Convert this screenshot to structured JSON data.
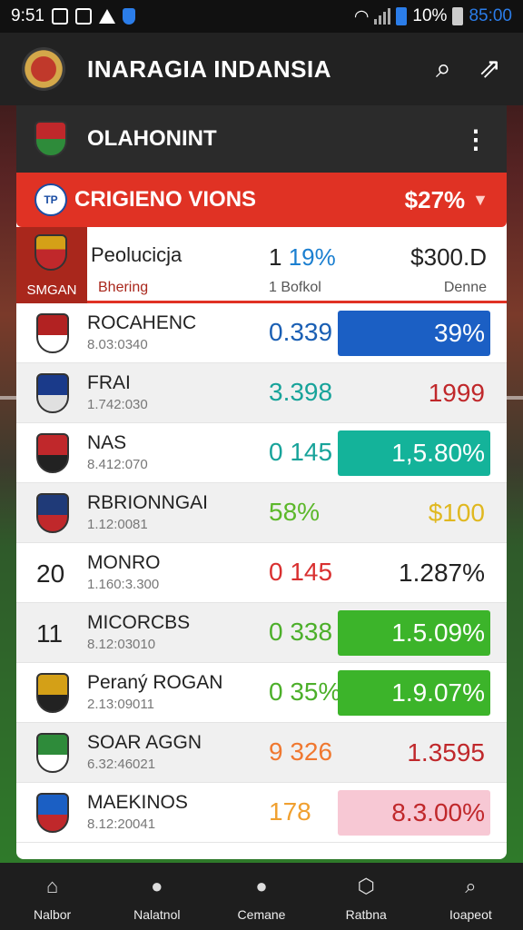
{
  "status_bar": {
    "left_text": "9:51",
    "wifi_percent": "10%",
    "time": "85:00"
  },
  "app_bar": {
    "title": "INARAGIA INDANSIA",
    "search_icon": "search-icon",
    "share_icon": "share-icon"
  },
  "card": {
    "title": "OLAHONINT",
    "more_icon": "more-vert-icon"
  },
  "banner": {
    "icon_text": "TP",
    "title": "CRIGIENO VIONS",
    "value": "$27%",
    "chevron_icon": "chevron-down-icon",
    "color": "#e03224"
  },
  "table_header": {
    "crest_label": "SMGAN",
    "col1_title": "Peolucicja",
    "col1_sub": "Bhering",
    "col2_title_prefix": "1",
    "col2_title_value": "19%",
    "col2_sub": "1   Bofkol",
    "col3_title": "$300.D",
    "col3_sub": "Denne"
  },
  "rows": [
    {
      "rank": "",
      "crest_colors": [
        "#b22222",
        "#ffffff"
      ],
      "name": "ROCAHENC",
      "sub": "8.03:0340",
      "mid": "0.339",
      "mid_color": "#1a5fb4",
      "value": "39%",
      "value_bg": "#1b5fc4",
      "value_color": "#ffffff"
    },
    {
      "rank": "",
      "crest_colors": [
        "#1a3a8a",
        "#e0e0e0"
      ],
      "name": "FRAI",
      "sub": "1.742:030",
      "mid": "3.398",
      "mid_color": "#17a39a",
      "value": "1999",
      "value_bg": "transparent",
      "value_color": "#c0282b"
    },
    {
      "rank": "",
      "crest_colors": [
        "#c0282b",
        "#222222"
      ],
      "name": "NAS",
      "sub": "8.412:070",
      "mid": "0 145",
      "mid_color": "#17a39a",
      "value": "1,5.80%",
      "value_bg": "#14b39a",
      "value_color": "#ffffff"
    },
    {
      "rank": "",
      "crest_colors": [
        "#1f3a78",
        "#c0282b"
      ],
      "name": "RBRIONNGAI",
      "sub": "1.12:0081",
      "mid": "58%",
      "mid_color": "#5cb82a",
      "value": "$100",
      "value_bg": "transparent",
      "value_color": "#e0b820"
    },
    {
      "rank": "20",
      "crest_colors": [],
      "name": "MONRO",
      "sub": "1.160:3.300",
      "mid": "0 145",
      "mid_color": "#d93030",
      "value": "1.287%",
      "value_bg": "transparent",
      "value_color": "#222222"
    },
    {
      "rank": "11",
      "crest_colors": [],
      "name": "MICORCBS",
      "sub": "8.12:03010",
      "mid": "0 338",
      "mid_color": "#4caf2a",
      "value": "1.5.09%",
      "value_bg": "#3cb42a",
      "value_color": "#ffffff"
    },
    {
      "rank": "",
      "crest_colors": [
        "#d4a017",
        "#222222"
      ],
      "name": "Peraný ROGAN",
      "sub": "2.13:09011",
      "mid": "0 35%",
      "mid_color": "#4caf2a",
      "value": "1.9.07%",
      "value_bg": "#3cb42a",
      "value_color": "#ffffff"
    },
    {
      "rank": "",
      "crest_colors": [
        "#2e8b3a",
        "#ffffff"
      ],
      "name": "SOAR AGGN",
      "sub": "6.32:46021",
      "mid": "9 326",
      "mid_color": "#f07830",
      "value": "1.3595",
      "value_bg": "transparent",
      "value_color": "#c0282b"
    },
    {
      "rank": "",
      "crest_colors": [
        "#1b5fc4",
        "#c0282b"
      ],
      "name": "MAEKINOS",
      "sub": "8.12:20041",
      "mid": "178",
      "mid_color": "#f0a030",
      "value": "8.3.00%",
      "value_bg": "#f7c8d4",
      "value_color": "#c0282b"
    }
  ],
  "nav": [
    {
      "label": "Nalbor",
      "icon": "home-icon",
      "active": false
    },
    {
      "label": "Nalatnol",
      "icon": "record-icon",
      "active": true
    },
    {
      "label": "Cemane",
      "icon": "record-icon",
      "active": true
    },
    {
      "label": "Ratbna",
      "icon": "hexagon-icon",
      "active": false
    },
    {
      "label": "Ioapeot",
      "icon": "search-icon",
      "active": false
    }
  ]
}
